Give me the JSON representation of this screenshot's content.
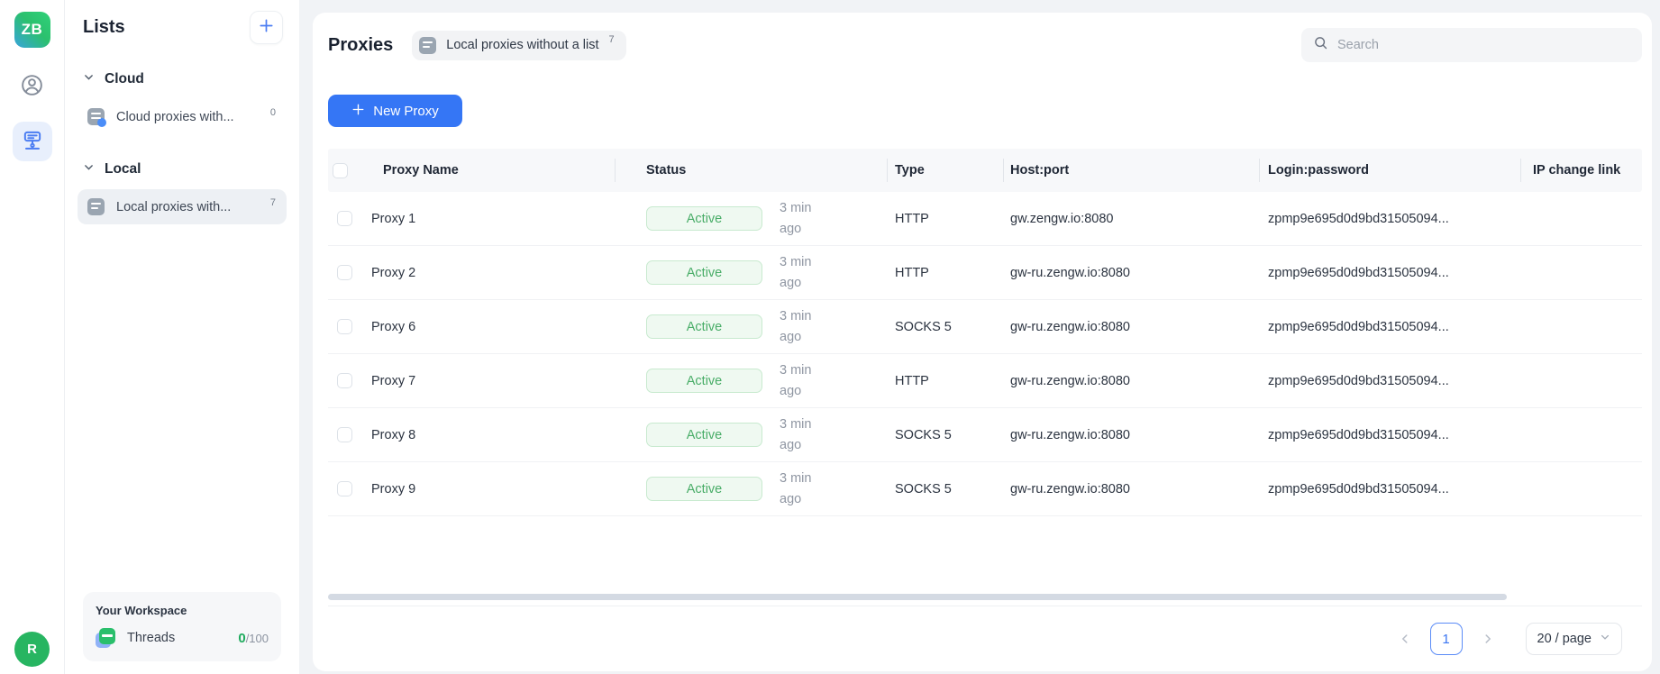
{
  "brand": {
    "logo_text": "ZB"
  },
  "rail": {
    "avatar_initial": "R"
  },
  "sidebar": {
    "title": "Lists",
    "sections": [
      {
        "label": "Cloud",
        "items": [
          {
            "label": "Cloud proxies with...",
            "count": "0"
          }
        ]
      },
      {
        "label": "Local",
        "items": [
          {
            "label": "Local proxies with...",
            "count": "7"
          }
        ]
      }
    ],
    "workspace": {
      "title": "Your Workspace",
      "metric_label": "Threads",
      "metric_value": "0",
      "metric_total": "/100"
    }
  },
  "header": {
    "title": "Proxies",
    "list_badge": {
      "label": "Local proxies without a list",
      "count": "7"
    },
    "search_placeholder": "Search"
  },
  "toolbar": {
    "new_proxy_label": "New Proxy"
  },
  "table": {
    "columns": [
      "Proxy Name",
      "Status",
      "Type",
      "Host:port",
      "Login:password",
      "IP change link"
    ],
    "rows": [
      {
        "name": "Proxy 1",
        "status": "Active",
        "updated": "3 min ago",
        "type": "HTTP",
        "host": "gw.zengw.io:8080",
        "login": "zpmp9e695d0d9bd31505094..."
      },
      {
        "name": "Proxy 2",
        "status": "Active",
        "updated": "3 min ago",
        "type": "HTTP",
        "host": "gw-ru.zengw.io:8080",
        "login": "zpmp9e695d0d9bd31505094..."
      },
      {
        "name": "Proxy 6",
        "status": "Active",
        "updated": "3 min ago",
        "type": "SOCKS 5",
        "host": "gw-ru.zengw.io:8080",
        "login": "zpmp9e695d0d9bd31505094..."
      },
      {
        "name": "Proxy 7",
        "status": "Active",
        "updated": "3 min ago",
        "type": "HTTP",
        "host": "gw-ru.zengw.io:8080",
        "login": "zpmp9e695d0d9bd31505094..."
      },
      {
        "name": "Proxy 8",
        "status": "Active",
        "updated": "3 min ago",
        "type": "SOCKS 5",
        "host": "gw-ru.zengw.io:8080",
        "login": "zpmp9e695d0d9bd31505094..."
      },
      {
        "name": "Proxy 9",
        "status": "Active",
        "updated": "3 min ago",
        "type": "SOCKS 5",
        "host": "gw-ru.zengw.io:8080",
        "login": "zpmp9e695d0d9bd31505094..."
      }
    ]
  },
  "pagination": {
    "page": "1",
    "page_size": "20 / page"
  },
  "colors": {
    "accent_blue": "#3576f5",
    "status_green": "#49ad68",
    "badge_bg": "#eff9f1",
    "avatar_green": "#27b561",
    "thread_green": "#1fab5e"
  }
}
